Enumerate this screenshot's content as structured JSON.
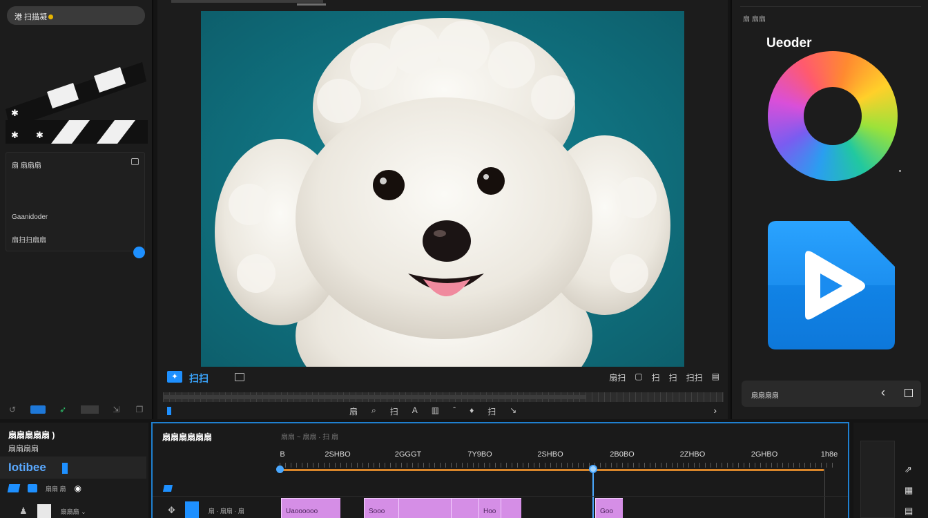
{
  "left_panel": {
    "search_label": "港 扫描凝",
    "props_title": "扇 扇扇扇",
    "props_line1": "Gaanidoder",
    "props_line2": "扇扫扫扇扇"
  },
  "preview": {
    "play_label": "扫扫",
    "right_tools": [
      "扇扫",
      "▢",
      "扫",
      "扫",
      "扫扫",
      "▤"
    ],
    "bottom_tools": [
      "扇",
      "⌕",
      "扫",
      "A",
      "▥",
      "ˆ",
      "♦",
      "扫",
      "↘"
    ],
    "chevron": "›"
  },
  "right_panel": {
    "top_label": "扇 扇扇",
    "encoder_title": "Ueoder",
    "bottom_label": "扇扇扇扇",
    "back_glyph": "‹",
    "accent_color": "#1e90ff"
  },
  "bottom_left": {
    "title": "扇扇扇扇扇 )",
    "subtitle": "扇扇扇扇",
    "project_name": "Iotibee",
    "row2_label": "扇扇 扇",
    "row3_label": "扇扇扇 ⌄"
  },
  "timeline": {
    "title": "扇扇扇扇扇扇",
    "meta": "扇扇 ~ 扇扇 · 扫 扇",
    "tick_labels": [
      "B",
      "2SHBO",
      "2GGGT",
      "7Y9BO",
      "2SHBO",
      "2B0BO",
      "2ZHBO",
      "2GHBO",
      "1h8e"
    ],
    "clips": [
      "Uaoooooo",
      "Sooo",
      "",
      "",
      "Hoo",
      "",
      "Goo"
    ],
    "track2_label": "扇 · 扇扇 · 扇"
  },
  "colors": {
    "accent_blue": "#1e90ff",
    "clip_pink": "#d58ee6",
    "playhead": "#4aa8ff",
    "range_orange": "#d9862a",
    "viewer_bg": "#11707f"
  }
}
